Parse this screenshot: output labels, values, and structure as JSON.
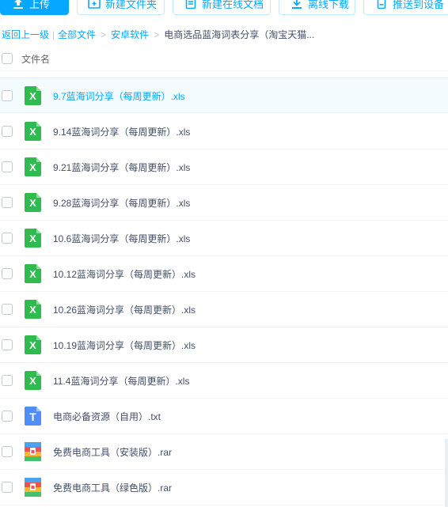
{
  "toolbar": {
    "upload": "上传",
    "new_folder": "新建文件夹",
    "new_online_doc": "新建在线文档",
    "offline_download": "离线下载",
    "push_to_device": "推送到设备"
  },
  "breadcrumb": {
    "back": "返回上一级",
    "all_files": "全部文件",
    "folder1": "安卓软件",
    "current": "电商选品蓝海词表分享（淘宝天猫..."
  },
  "list_header": {
    "title": "文件名"
  },
  "files": [
    {
      "name": "9.7蓝海词分享（每周更新）.xls",
      "type": "xls",
      "icon_letter": "X"
    },
    {
      "name": "9.14蓝海词分享（每周更新）.xls",
      "type": "xls",
      "icon_letter": "X"
    },
    {
      "name": "9.21蓝海词分享（每周更新）.xls",
      "type": "xls",
      "icon_letter": "X"
    },
    {
      "name": "9.28蓝海词分享（每周更新）.xls",
      "type": "xls",
      "icon_letter": "X"
    },
    {
      "name": "10.6蓝海词分享（每周更新）.xls",
      "type": "xls",
      "icon_letter": "X"
    },
    {
      "name": "10.12蓝海词分享（每周更新）.xls",
      "type": "xls",
      "icon_letter": "X"
    },
    {
      "name": "10.26蓝海词分享（每周更新）.xls",
      "type": "xls",
      "icon_letter": "X"
    },
    {
      "name": "10.19蓝海词分享（每周更新）.xls",
      "type": "xls",
      "icon_letter": "X"
    },
    {
      "name": "11.4蓝海词分享（每周更新）.xls",
      "type": "xls",
      "icon_letter": "X"
    },
    {
      "name": "电商必备资源（自用）.txt",
      "type": "txt",
      "icon_letter": "T"
    },
    {
      "name": "免费电商工具（安装版）.rar",
      "type": "rar",
      "icon_letter": ""
    },
    {
      "name": "免费电商工具（绿色版）.rar",
      "type": "rar",
      "icon_letter": ""
    }
  ],
  "colors": {
    "accent": "#06a7ff",
    "xls_icon": "#2fbb4f",
    "txt_icon": "#4f8ef7",
    "text": "#424e67"
  }
}
